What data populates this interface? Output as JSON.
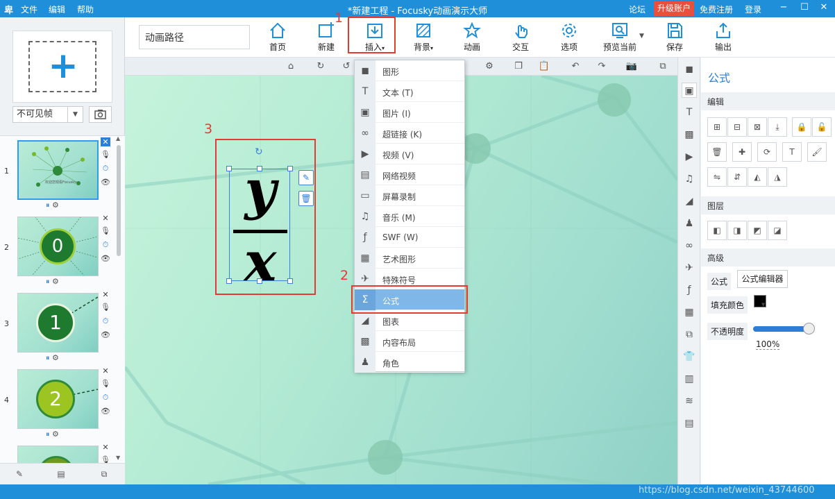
{
  "titlebar": {
    "logo": "卑",
    "menu": [
      "文件",
      "编辑",
      "帮助"
    ],
    "title": "*新建工程 - Focusky动画演示大师",
    "forum": "论坛",
    "upgrade": "升级账户",
    "register": "免费注册",
    "login": "登录",
    "minimize": "−",
    "maximize": "☐",
    "close": "✕"
  },
  "toolbar": {
    "path_value": "动画路径",
    "buttons": [
      "首页",
      "新建",
      "插入",
      "背景",
      "动画",
      "交互",
      "选项",
      "预览当前",
      "保存",
      "输出"
    ],
    "annotation_1": "1"
  },
  "leftpanel": {
    "add_symbol": "+",
    "frame_mode": "不可见帧",
    "slides": [
      "1",
      "2",
      "3",
      "4"
    ],
    "slide_labels": [
      "0",
      "1",
      "2"
    ],
    "thumb1_text": "欢迎您观看Focusky"
  },
  "canvas": {
    "annotation_3": "3",
    "formula_numerator": "y",
    "formula_denominator": "x"
  },
  "dropdown": {
    "items": [
      {
        "icon": "shape-icon",
        "glyph": "◼",
        "label": "图形"
      },
      {
        "icon": "text-icon",
        "glyph": "T",
        "label": "文本 (T)"
      },
      {
        "icon": "image-icon",
        "glyph": "▣",
        "label": "图片 (I)"
      },
      {
        "icon": "link-icon",
        "glyph": "∞",
        "label": "超链接 (K)"
      },
      {
        "icon": "video-icon",
        "glyph": "▶",
        "label": "视频 (V)"
      },
      {
        "icon": "youtube-icon",
        "glyph": "▤",
        "label": "网络视频"
      },
      {
        "icon": "screen-record-icon",
        "glyph": "▭",
        "label": "屏幕录制"
      },
      {
        "icon": "music-icon",
        "glyph": "♫",
        "label": "音乐 (M)"
      },
      {
        "icon": "swf-icon",
        "glyph": "ƒ",
        "label": "SWF (W)"
      },
      {
        "icon": "art-shape-icon",
        "glyph": "▦",
        "label": "艺术图形"
      },
      {
        "icon": "special-symbol-icon",
        "glyph": "✈",
        "label": "特殊符号"
      },
      {
        "icon": "formula-icon",
        "glyph": "Σ",
        "label": "公式"
      },
      {
        "icon": "chart-icon",
        "glyph": "◢",
        "label": "图表"
      },
      {
        "icon": "layout-icon",
        "glyph": "▩",
        "label": "内容布局"
      },
      {
        "icon": "role-icon",
        "glyph": "♟",
        "label": "角色"
      }
    ],
    "selected_index": 11,
    "annotation_2": "2"
  },
  "props": {
    "title": "公式",
    "section_edit": "编辑",
    "section_layer": "图层",
    "section_advanced": "高级",
    "formula_label": "公式",
    "formula_editor": "公式编辑器",
    "fill_color_label": "填充颜色",
    "fill_color": "#000000",
    "opacity_label": "不透明度",
    "opacity_value": "100%",
    "opacity_fraction": 1.0
  },
  "statusbar": {
    "watermark": "https://blog.csdn.net/weixin_43744600"
  },
  "colors": {
    "accent": "#1e8fd8",
    "highlight_red": "#e53a32",
    "menu_selected": "#7fb8e8"
  }
}
